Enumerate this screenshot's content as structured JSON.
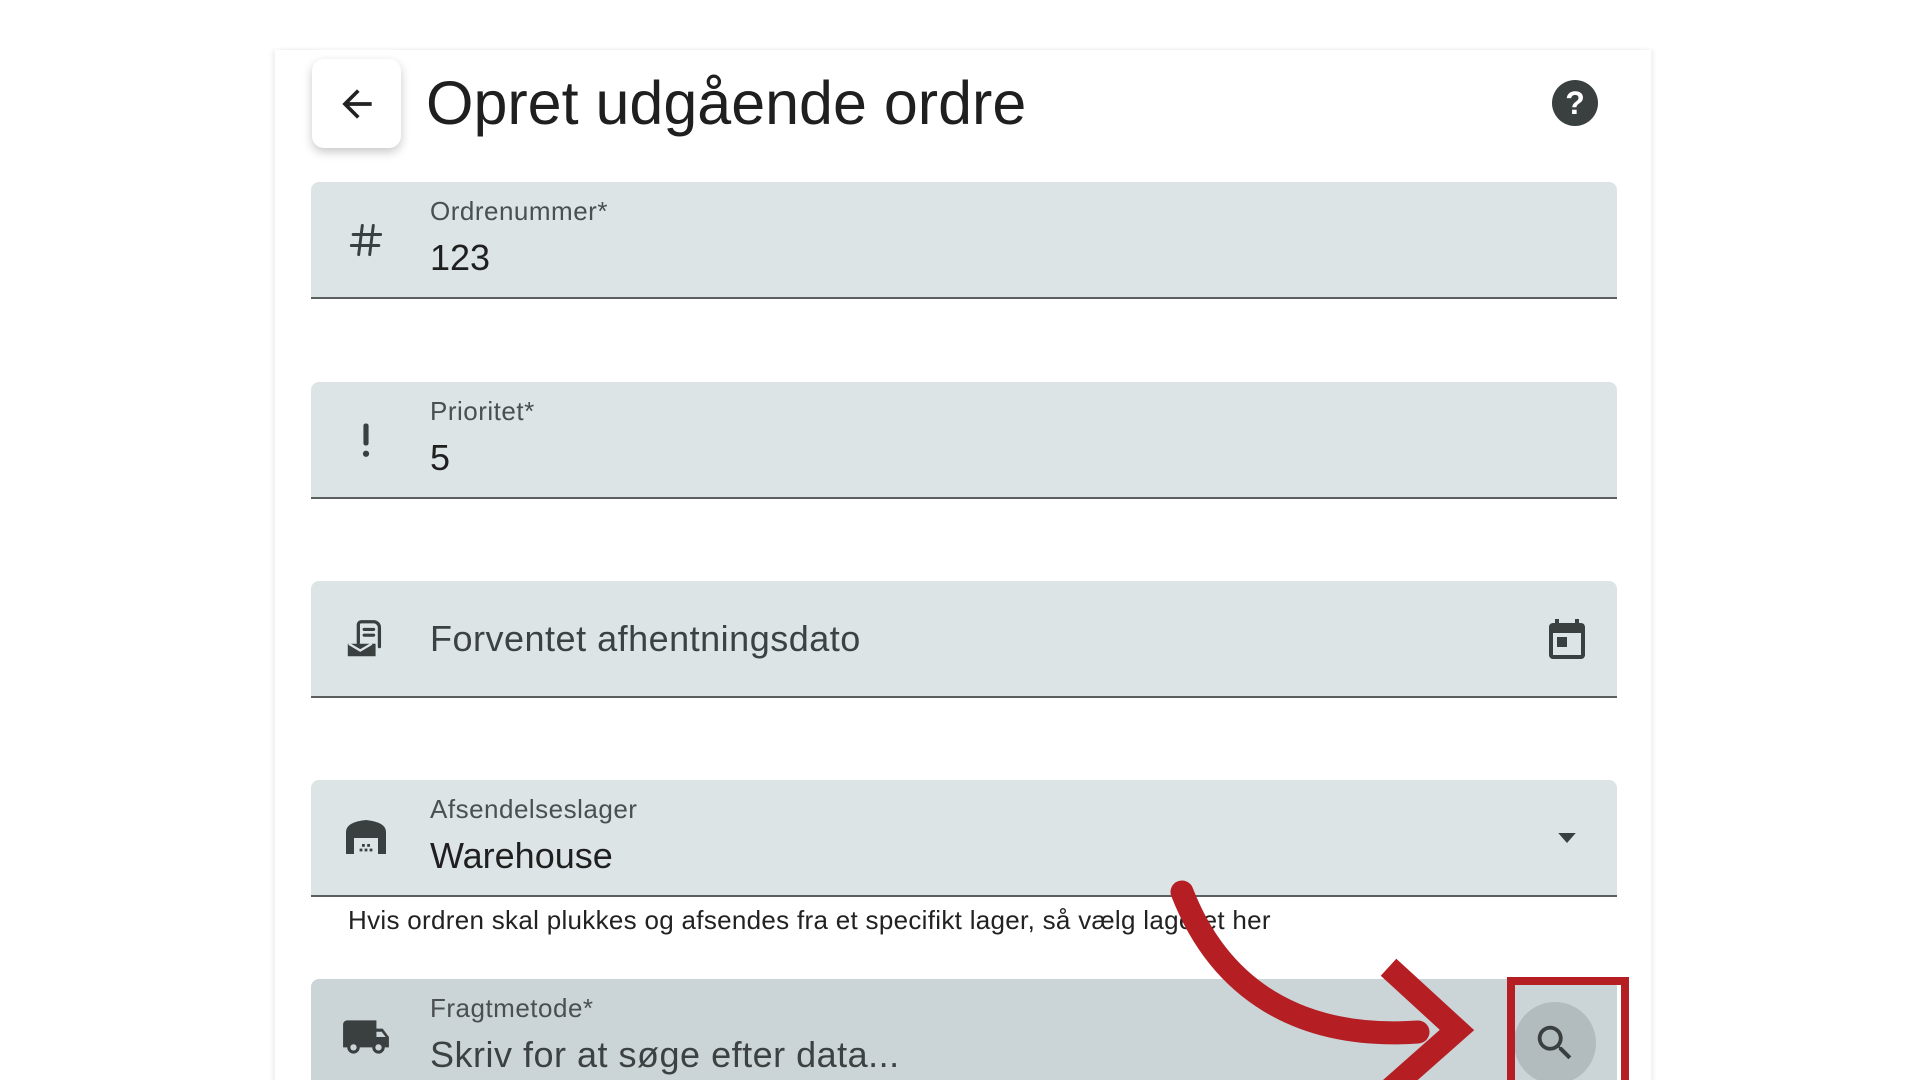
{
  "header": {
    "title": "Opret udgående ordre",
    "help_label": "?"
  },
  "fields": {
    "order_number": {
      "label": "Ordrenummer*",
      "value": "123",
      "icon": "hash-icon"
    },
    "priority": {
      "label": "Prioritet*",
      "value": "5",
      "icon": "exclamation-icon"
    },
    "pickup_date": {
      "placeholder": "Forventet afhentningsdato",
      "icon": "pickup-package-icon",
      "trailing_icon": "calendar-icon"
    },
    "warehouse": {
      "label": "Afsendelseslager",
      "value": "Warehouse",
      "icon": "warehouse-icon",
      "trailing_icon": "dropdown-arrow-icon",
      "helper": "Hvis ordren skal plukkes og afsendes fra et specifikt lager, så vælg lageret her"
    },
    "freight_method": {
      "label": "Fragtmetode*",
      "placeholder": "Skriv for at søge efter data...",
      "icon": "truck-icon",
      "trailing_icon": "search-icon"
    }
  },
  "colors": {
    "field_bg": "#dce4e5",
    "field_active_bg": "#cbd5d7",
    "annotation": "#b51f24",
    "icon": "#3a3f40"
  }
}
